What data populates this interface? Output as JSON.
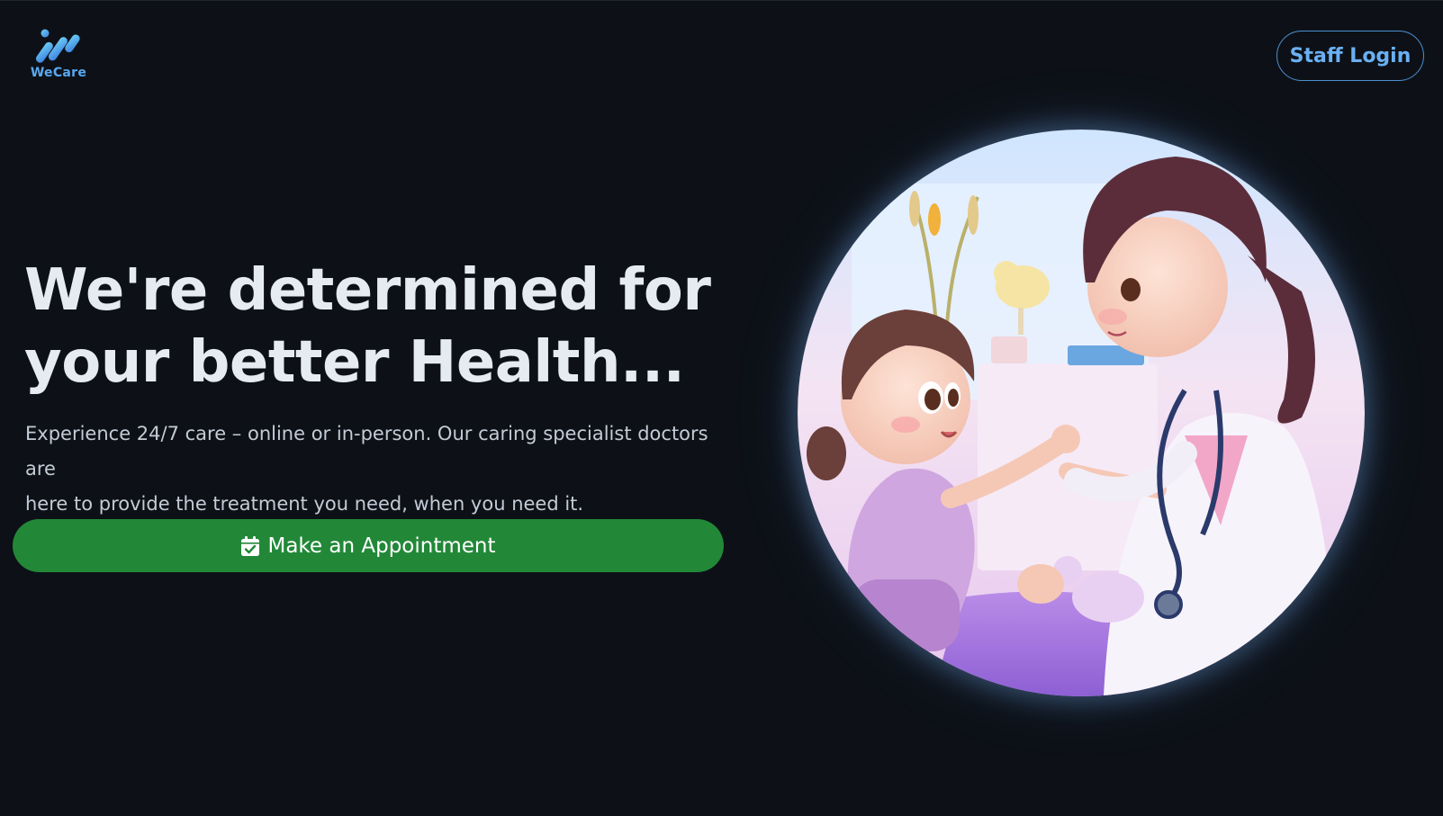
{
  "brand": {
    "name": "WeCare",
    "logo_icon": "wecare-logo-icon",
    "accent": "#5aa8ee"
  },
  "header": {
    "staff_login_label": "Staff Login"
  },
  "hero": {
    "headline_line1": "We're determined for",
    "headline_line2": "your better Health...",
    "subtext_line1": "Experience 24/7 care – online or in-person. Our caring specialist doctors are",
    "subtext_line2": "here to provide the treatment you need, when you need it.",
    "cta_label": "Make an Appointment",
    "cta_icon": "calendar-check-icon",
    "cta_color": "#228838",
    "illustration": "doctor-child-illustration"
  },
  "colors": {
    "background": "#0d1117",
    "headline": "#e6ebf2",
    "subtext": "#c4cbd6"
  }
}
